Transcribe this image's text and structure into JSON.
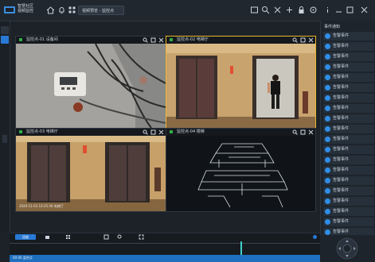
{
  "app": {
    "logo_text_line1": "智慧社区",
    "logo_text_line2": "视频监控",
    "tab_label": "视频预览 - 监控点"
  },
  "panes": [
    {
      "title": "监控点-01 设备间",
      "active": false,
      "dot_color": "#2fb24a"
    },
    {
      "title": "监控点-02 电梯厅",
      "active": true,
      "dot_color": "#2fb24a"
    },
    {
      "title": "监控点-03 电梯厅",
      "active": false,
      "dot_color": "#2fb24a"
    },
    {
      "title": "监控点-04 楼梯",
      "active": false,
      "dot_color": "#2fb24a"
    }
  ],
  "overlays": {
    "pane3_caption": "2020-11-03 10:25:36 电梯厅"
  },
  "right_panel": {
    "title": "事件通知",
    "items": [
      {
        "label": "告警事件"
      },
      {
        "label": "告警事件"
      },
      {
        "label": "告警事件"
      },
      {
        "label": "告警事件"
      },
      {
        "label": "告警事件"
      },
      {
        "label": "告警事件"
      },
      {
        "label": "告警事件"
      },
      {
        "label": "告警事件"
      },
      {
        "label": "告警事件"
      },
      {
        "label": "告警事件"
      },
      {
        "label": "告警事件"
      },
      {
        "label": "告警事件"
      },
      {
        "label": "告警事件"
      },
      {
        "label": "告警事件"
      },
      {
        "label": "告警事件"
      },
      {
        "label": "告警事件"
      },
      {
        "label": "告警事件"
      },
      {
        "label": "告警事件"
      },
      {
        "label": "告警事件"
      },
      {
        "label": "告警事件"
      }
    ]
  },
  "timeline": {
    "play_label": "回放",
    "bottom_label": "00:00 监控点"
  },
  "colors": {
    "accent": "#2979d6",
    "active_border": "#e9b72b",
    "online": "#2fb24a"
  },
  "icons": [
    "logo-icon",
    "home-icon",
    "bell-icon",
    "search-icon",
    "grid-icon",
    "close-icon",
    "settings-icon",
    "window-icon",
    "fullscreen-icon",
    "camera-icon"
  ]
}
